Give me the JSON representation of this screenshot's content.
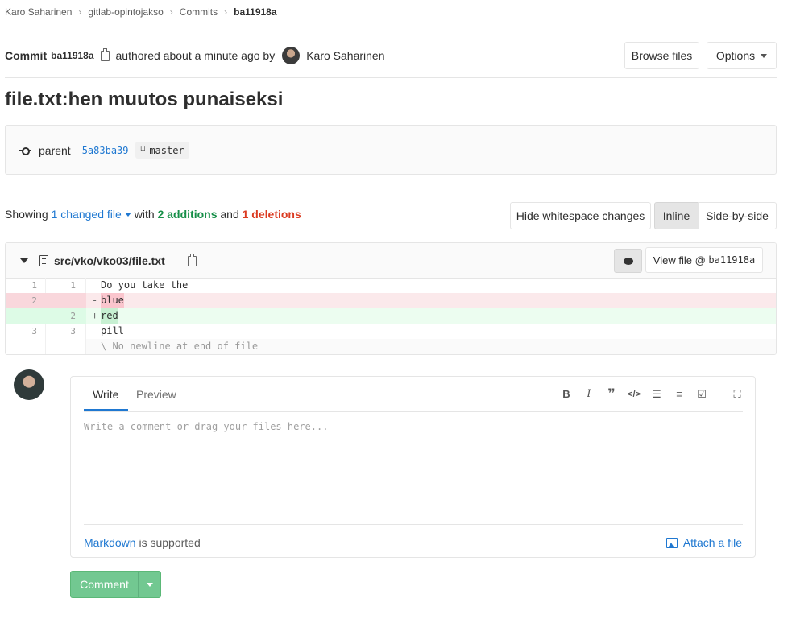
{
  "breadcrumb": {
    "items": [
      "Karo Saharinen",
      "gitlab-opintojakso",
      "Commits",
      "ba11918a"
    ]
  },
  "commit": {
    "label": "Commit",
    "short_sha": "ba11918a",
    "authored_text": "authored about a minute ago by",
    "author": "Karo Saharinen",
    "title": "file.txt:hen muutos punaiseksi",
    "parent_label": "parent",
    "parent_sha": "5a83ba39",
    "branch": "master"
  },
  "actions": {
    "browse_files": "Browse files",
    "options": "Options"
  },
  "stats": {
    "showing": "Showing",
    "changed_files": "1 changed file",
    "with": "with",
    "additions": "2 additions",
    "and": "and",
    "deletions": "1 deletions"
  },
  "view_controls": {
    "hide_whitespace": "Hide whitespace changes",
    "inline": "Inline",
    "side_by_side": "Side-by-side"
  },
  "diff": {
    "file_path": "src/vko/vko03/file.txt",
    "view_file_prefix": "View file @",
    "view_file_sha": "ba11918a",
    "lines": [
      {
        "old": "1",
        "new": "1",
        "marker": "",
        "text": "Do you take the",
        "type": "context"
      },
      {
        "old": "2",
        "new": "",
        "marker": "-",
        "text": "blue",
        "type": "old"
      },
      {
        "old": "",
        "new": "2",
        "marker": "+",
        "text": "red",
        "type": "new"
      },
      {
        "old": "3",
        "new": "3",
        "marker": "",
        "text": "pill",
        "type": "context"
      },
      {
        "old": "",
        "new": "",
        "marker": "",
        "text": "\\ No newline at end of file",
        "type": "meta"
      }
    ]
  },
  "comment_form": {
    "tab_write": "Write",
    "tab_preview": "Preview",
    "placeholder": "Write a comment or drag your files here...",
    "markdown_link": "Markdown",
    "supported_text": "is supported",
    "attach": "Attach a file",
    "submit": "Comment"
  },
  "toolbar_icons": [
    "bold-icon",
    "italic-icon",
    "quote-icon",
    "code-icon",
    "bullet-list-icon",
    "numbered-list-icon",
    "task-list-icon",
    "fullscreen-icon"
  ]
}
